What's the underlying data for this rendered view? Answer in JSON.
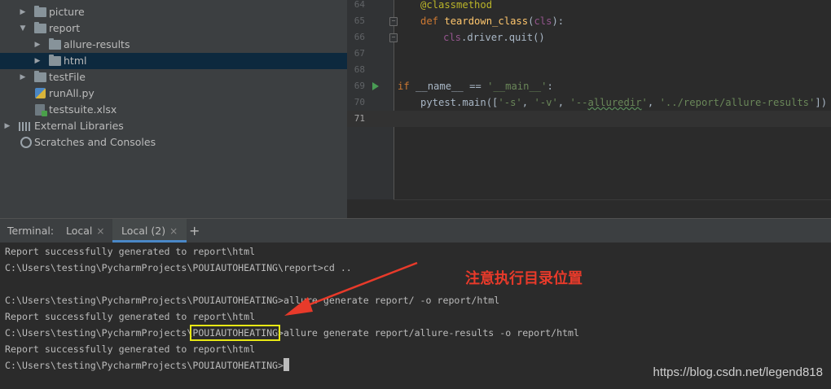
{
  "project_tree": {
    "items": [
      {
        "label": "picture",
        "icon": "folder-icon"
      },
      {
        "label": "report",
        "icon": "folder-icon"
      },
      {
        "label": "allure-results",
        "icon": "folder-icon"
      },
      {
        "label": "html",
        "icon": "folder-icon"
      },
      {
        "label": "testFile",
        "icon": "folder-icon"
      },
      {
        "label": "runAll.py",
        "icon": "python-file-icon"
      },
      {
        "label": "testsuite.xlsx",
        "icon": "excel-file-icon"
      },
      {
        "label": "External Libraries",
        "icon": "library-icon"
      },
      {
        "label": "Scratches and Consoles",
        "icon": "scratches-icon"
      }
    ]
  },
  "editor": {
    "line_numbers": [
      "64",
      "65",
      "66",
      "67",
      "68",
      "69",
      "70",
      "71"
    ],
    "lines": {
      "l64": "@classmethod",
      "l65_kw": "def",
      "l65_fn": "teardown_class",
      "l65_param": "cls",
      "l66_self": "cls",
      "l66_rest": ".driver.quit()",
      "l69_kw": "if",
      "l69_name": "__name__",
      "l69_op": " == ",
      "l69_str": "'__main__'",
      "l70_call": "pytest.main([",
      "l70_s1": "'-s'",
      "l70_s2": "'-v'",
      "l70_s3_a": "'--",
      "l70_s3_b": "alluredir",
      "l70_s3_c": "'",
      "l70_s4": "'../report/allure-results'",
      "l70_end": "])"
    }
  },
  "terminal": {
    "header_label": "Terminal:",
    "tabs": [
      {
        "label": "Local",
        "close": "×"
      },
      {
        "label": "Local (2)",
        "close": "×"
      }
    ],
    "add_tab": "+",
    "lines": [
      "Report successfully generated to report\\html",
      "C:\\Users\\testing\\PycharmProjects\\POUIAUTOHEATING\\report>cd ..",
      "",
      "C:\\Users\\testing\\PycharmProjects\\POUIAUTOHEATING>allure generate report/ -o report/html",
      "Report successfully generated to report\\html"
    ],
    "line6_prefix": "C:\\Users\\testing\\PycharmProjects\\",
    "line6_highlight": "POUIAUTOHEATING",
    "line6_suffix": ">allure generate report/allure-results -o report/html",
    "line7": "Report successfully generated to report\\html",
    "prompt": "C:\\Users\\testing\\PycharmProjects\\POUIAUTOHEATING>"
  },
  "annotation": {
    "text": "注意执行目录位置",
    "color": "#e83a2a",
    "highlight_color": "#e8e814"
  },
  "watermark": "https://blog.csdn.net/legend818",
  "colors": {
    "selection": "#0d293e",
    "keyword": "#cc7832",
    "string": "#6a8759",
    "decorator": "#bbb529",
    "function": "#ffc66d",
    "active_tab_underline": "#4a88c7"
  }
}
